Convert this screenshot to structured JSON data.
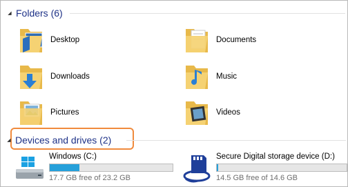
{
  "groups": {
    "folders": {
      "title": "Folders (6)",
      "collapsed": false
    },
    "devices": {
      "title": "Devices and drives (2)",
      "collapsed": false
    }
  },
  "folders": [
    {
      "label": "Desktop",
      "icon": "desktop-folder-icon"
    },
    {
      "label": "Documents",
      "icon": "documents-folder-icon"
    },
    {
      "label": "Downloads",
      "icon": "downloads-folder-icon"
    },
    {
      "label": "Music",
      "icon": "music-folder-icon"
    },
    {
      "label": "Pictures",
      "icon": "pictures-folder-icon"
    },
    {
      "label": "Videos",
      "icon": "videos-folder-icon"
    }
  ],
  "drives": [
    {
      "name": "Windows (C:)",
      "free_text": "17.7 GB free of 23.2 GB",
      "used_fraction": 0.24,
      "icon": "windows-drive-icon"
    },
    {
      "name": "Secure Digital storage device (D:)",
      "free_text": "14.5 GB free of 14.6 GB",
      "used_fraction": 0.01,
      "icon": "sd-card-drive-icon"
    }
  ],
  "colors": {
    "group_title": "#1e3287",
    "highlight": "#f08a3c",
    "drive_bar_fill": "#26a0da",
    "folder_yellow": "#f5d273"
  }
}
